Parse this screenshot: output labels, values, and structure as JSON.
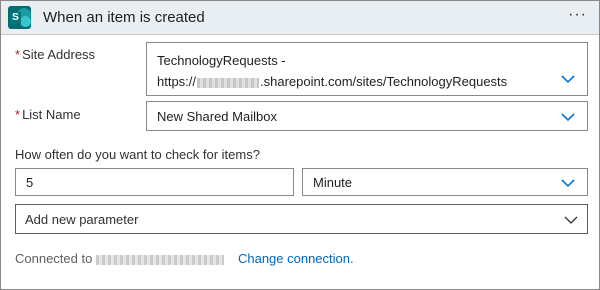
{
  "header": {
    "title": "When an item is created",
    "more_label": "···",
    "icon": "sharepoint-logo"
  },
  "site_address": {
    "label": "Site Address",
    "required_mark": "*",
    "line1": "TechnologyRequests -",
    "url_prefix": "https://",
    "url_suffix": ".sharepoint.com/sites/TechnologyRequests"
  },
  "list_name": {
    "label": "List Name",
    "required_mark": "*",
    "value": "New Shared Mailbox"
  },
  "frequency": {
    "question": "How often do you want to check for items?",
    "interval": "5",
    "unit": "Minute"
  },
  "add_parameter": {
    "placeholder": "Add new parameter"
  },
  "connection": {
    "prefix": "Connected to",
    "change_link": "Change connection."
  },
  "colors": {
    "header_bg": "#e9eef2",
    "chevron": "#0078d4",
    "link": "#0067b8",
    "required": "#a4262c"
  }
}
